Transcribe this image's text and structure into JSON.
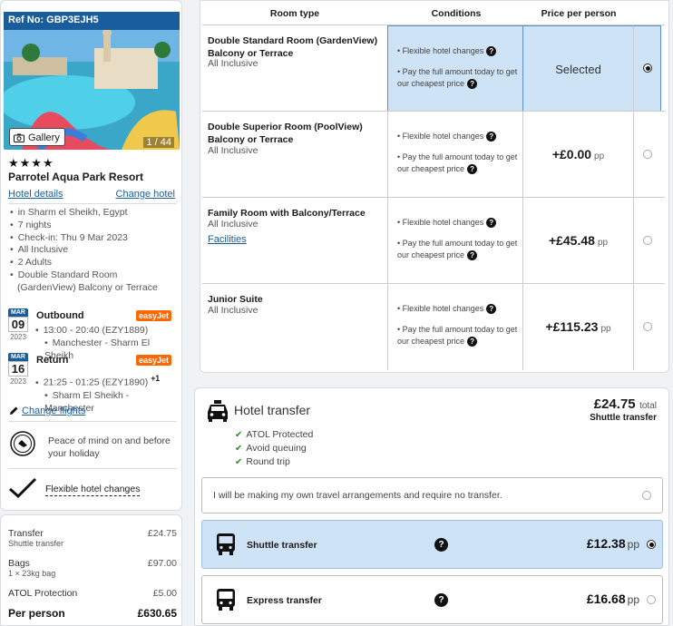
{
  "hotel": {
    "ref": "Ref No: GBP3EJH5",
    "gallery_label": "Gallery",
    "photo_count": "1 / 44",
    "stars": "★★★★",
    "name": "Parrotel Aqua Park Resort",
    "details_link": "Hotel details",
    "change_link": "Change hotel",
    "facts": [
      "in Sharm el Sheikh, Egypt",
      "7 nights",
      "Check-in: Thu 9 Mar 2023",
      "All Inclusive",
      "2 Adults",
      "Double Standard Room (GardenView) Balcony or Terrace"
    ]
  },
  "flights": {
    "outbound": {
      "month": "MAR",
      "day": "09",
      "year": "2023",
      "title": "Outbound",
      "airline": "easyJet",
      "time": "13:00 - 20:40 (EZY1889)",
      "route": "Manchester - Sharm El Sheikh"
    },
    "return": {
      "month": "MAR",
      "day": "16",
      "year": "2023",
      "title": "Return",
      "airline": "easyJet",
      "time": "21:25 - 01:25 (EZY1890)",
      "plus": "+1",
      "route": "Sharm El Sheikh - Manchester"
    },
    "change_link": "Change flights"
  },
  "assurance": {
    "peace": "Peace of mind on and before your holiday",
    "flexible": "Flexible hotel changes"
  },
  "summary": {
    "rows": [
      {
        "label": "Transfer",
        "sub": "Shuttle transfer",
        "value": "£24.75"
      },
      {
        "label": "Bags",
        "sub": "1 × 23kg bag",
        "value": "£97.00"
      },
      {
        "label": "ATOL Protection",
        "sub": "",
        "value": "£5.00"
      }
    ],
    "per_person_label": "Per person",
    "per_person_value": "£630.65"
  },
  "rooms": {
    "headers": {
      "type": "Room type",
      "conditions": "Conditions",
      "price": "Price per person"
    },
    "cond1": "Flexible hotel changes",
    "cond2": "Pay the full amount today to get our cheapest price",
    "pp": "pp",
    "items": [
      {
        "name": "Double Standard Room (GardenView) Balcony or Terrace",
        "board": "All Inclusive",
        "link": "",
        "price": "Selected",
        "selected": true
      },
      {
        "name": "Double Superior Room (PoolView) Balcony or Terrace",
        "board": "All Inclusive",
        "link": "",
        "price": "+£0.00",
        "selected": false
      },
      {
        "name": "Family Room with Balcony/Terrace",
        "board": "All Inclusive",
        "link": "Facilities",
        "price": "+£45.48",
        "selected": false
      },
      {
        "name": "Junior Suite",
        "board": "All Inclusive",
        "link": "",
        "price": "+£115.23",
        "selected": false
      }
    ]
  },
  "transfer": {
    "title": "Hotel transfer",
    "price": "£24.75",
    "total_label": "total",
    "type": "Shuttle transfer",
    "features": [
      "ATOL Protected",
      "Avoid queuing",
      "Round trip"
    ],
    "no_transfer": "I will be making my own travel arrangements and require no transfer.",
    "options": [
      {
        "label": "Shuttle transfer",
        "price": "£12.38",
        "selected": true
      },
      {
        "label": "Express transfer",
        "price": "£16.68",
        "selected": false
      }
    ],
    "pp": "pp"
  }
}
